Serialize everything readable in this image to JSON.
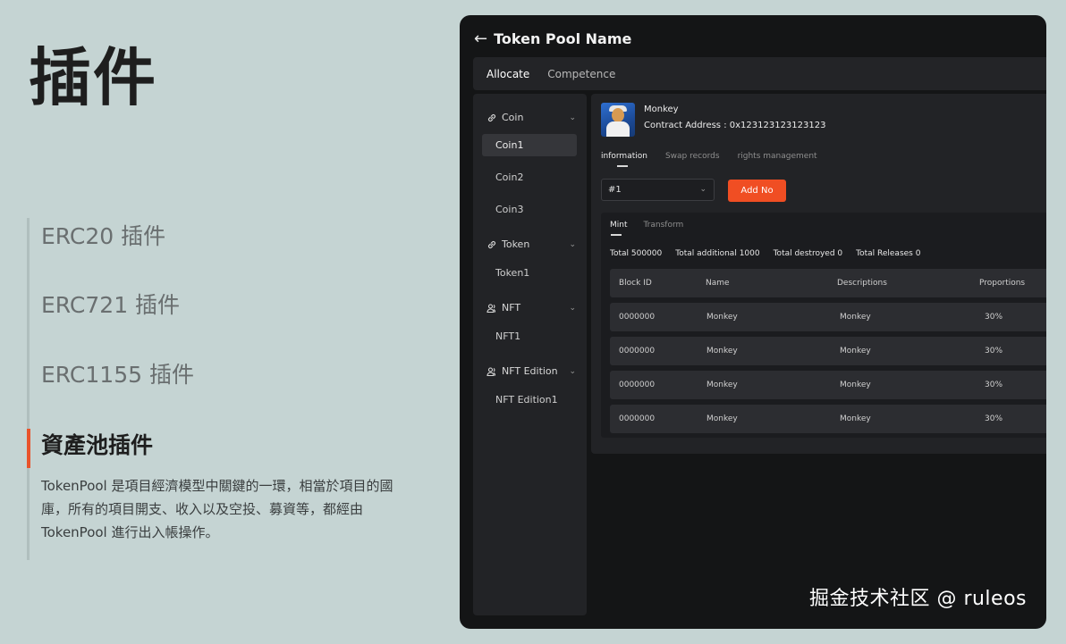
{
  "page": {
    "title": "插件",
    "features": [
      "ERC20 插件",
      "ERC721 插件",
      "ERC1155 插件"
    ],
    "active_feature": "資產池插件",
    "active_description": "TokenPool 是項目經濟模型中關鍵的一環，相當於項目的國庫，所有的項目開支、收入以及空投、募資等，都經由 TokenPool 進行出入帳操作。"
  },
  "app": {
    "title": "Token Pool Name",
    "top_tabs": [
      "Allocate",
      "Competence"
    ],
    "sidebar": {
      "groups": [
        {
          "label": "Coin",
          "icon": "link-icon",
          "items": [
            "Coin1",
            "Coin2",
            "Coin3"
          ]
        },
        {
          "label": "Token",
          "icon": "link-icon",
          "items": [
            "Token1"
          ]
        },
        {
          "label": "NFT",
          "icon": "users-icon",
          "items": [
            "NFT1"
          ]
        },
        {
          "label": "NFT Edition",
          "icon": "users-icon",
          "items": [
            "NFT Edition1"
          ]
        }
      ],
      "selected": "Coin1"
    },
    "token": {
      "name": "Monkey",
      "contract": "Contract Address : 0x123123123123123"
    },
    "inner_tabs": [
      "information",
      "Swap records",
      "rights management"
    ],
    "select_value": "#1",
    "add_button": "Add No",
    "sub_tabs": [
      "Mint",
      "Transform"
    ],
    "stats": [
      "Total 500000",
      "Total additional 1000",
      "Total destroyed 0",
      "Total Releases 0"
    ],
    "table": {
      "columns": [
        "Block ID",
        "Name",
        "Descriptions",
        "Proportions"
      ],
      "rows": [
        [
          "0000000",
          "Monkey",
          "Monkey",
          "30%"
        ],
        [
          "0000000",
          "Monkey",
          "Monkey",
          "30%"
        ],
        [
          "0000000",
          "Monkey",
          "Monkey",
          "30%"
        ],
        [
          "0000000",
          "Monkey",
          "Monkey",
          "30%"
        ]
      ]
    },
    "accent_color": "#f04e23"
  },
  "watermark": "掘金技术社区 @ ruleos"
}
